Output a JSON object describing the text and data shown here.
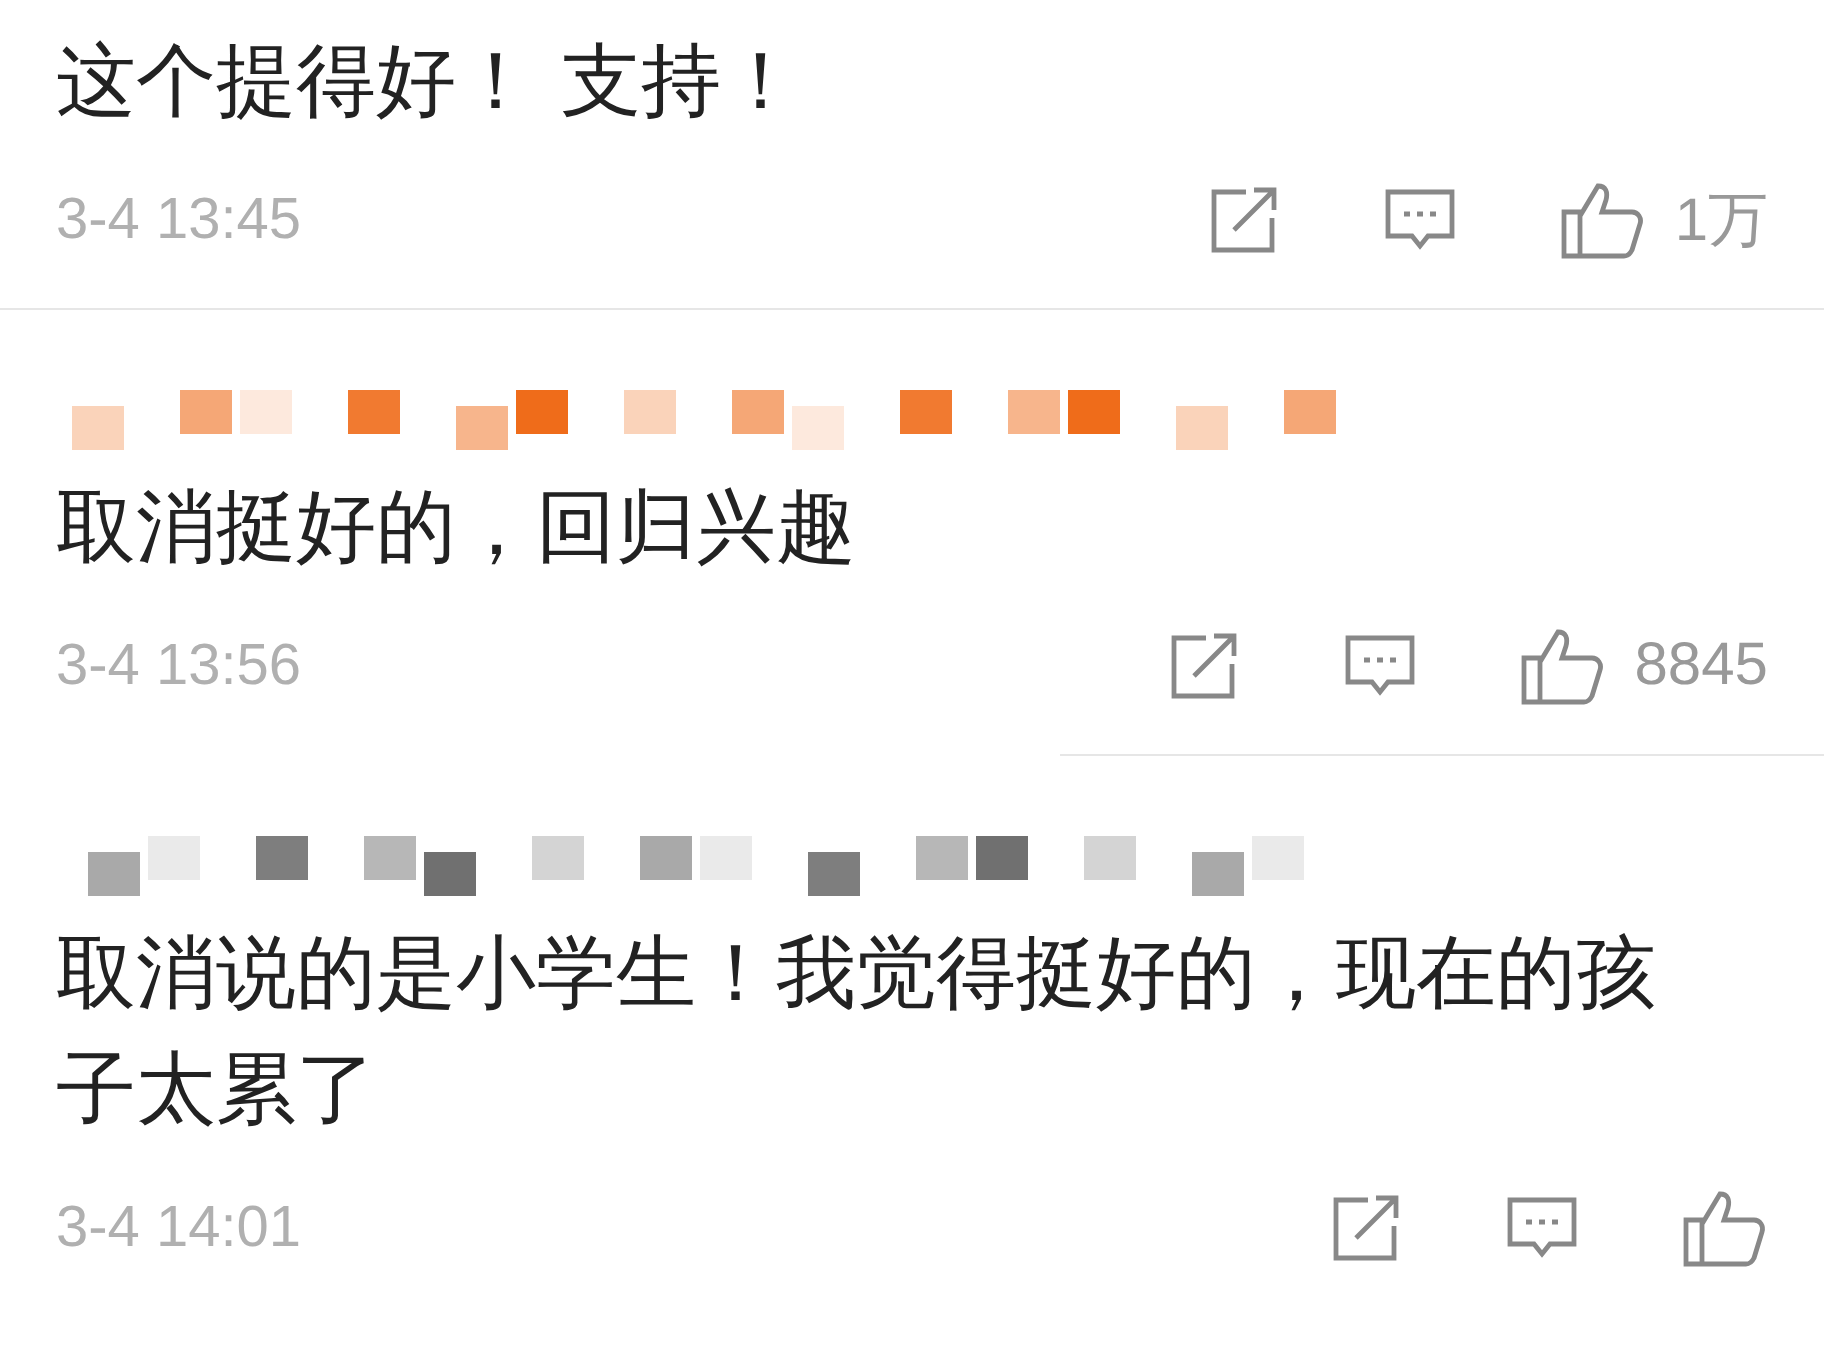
{
  "comments": [
    {
      "text": "这个提得好！ 支持！",
      "time": "3-4 13:45",
      "likes": "1万",
      "divider": {
        "inset": false
      }
    },
    {
      "name": {
        "kind": "mosaic",
        "color": "#ef6c1a"
      },
      "text": "取消挺好的，回归兴趣",
      "time": "3-4 13:56",
      "likes": "8845",
      "divider": {
        "inset": true
      }
    },
    {
      "name": {
        "kind": "mosaic",
        "color": "#707070"
      },
      "text": "取消说的是小学生！我觉得挺好的，现在的孩子太累了",
      "time": "3-4 14:01"
    }
  ]
}
